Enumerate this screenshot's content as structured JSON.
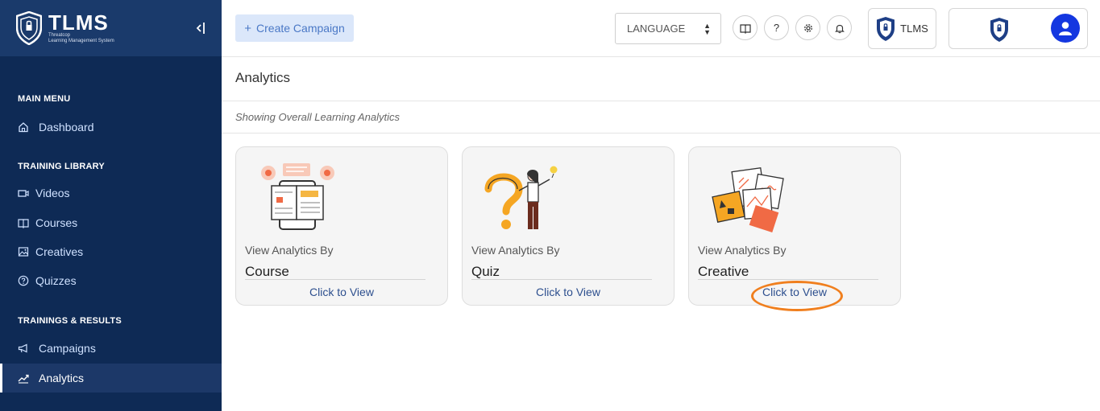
{
  "brand": {
    "name": "TLMS",
    "tagline_line1": "Threatcop",
    "tagline_line2": "Learning Management System",
    "collapse_icon": "collapse-left-icon"
  },
  "sidebar": {
    "sections": [
      {
        "title": "MAIN MENU"
      },
      {
        "title": "TRAINING LIBRARY"
      },
      {
        "title": "TRAININGS & RESULTS"
      }
    ],
    "items": [
      {
        "label": "Dashboard",
        "icon": "home-icon"
      },
      {
        "label": "Videos",
        "icon": "video-icon"
      },
      {
        "label": "Courses",
        "icon": "book-icon"
      },
      {
        "label": "Creatives",
        "icon": "image-icon"
      },
      {
        "label": "Quizzes",
        "icon": "question-icon"
      },
      {
        "label": "Campaigns",
        "icon": "megaphone-icon"
      },
      {
        "label": "Analytics",
        "icon": "chart-line-icon",
        "active": true
      }
    ]
  },
  "topbar": {
    "create_label": "Create Campaign",
    "language_label": "LANGUAGE",
    "tlms_label": "TLMS"
  },
  "main": {
    "title": "Analytics",
    "subtitle": "Showing Overall Learning Analytics",
    "cards": [
      {
        "by": "View Analytics By",
        "name": "Course",
        "cta": "Click to View"
      },
      {
        "by": "View Analytics By",
        "name": "Quiz",
        "cta": "Click to View"
      },
      {
        "by": "View Analytics By",
        "name": "Creative",
        "cta": "Click to View"
      }
    ]
  },
  "colors": {
    "sidebar_bg": "#0e2a55",
    "brand_bg": "#1a3a6b",
    "accent_orange": "#f07f1e",
    "avatar_blue": "#1437e0"
  }
}
